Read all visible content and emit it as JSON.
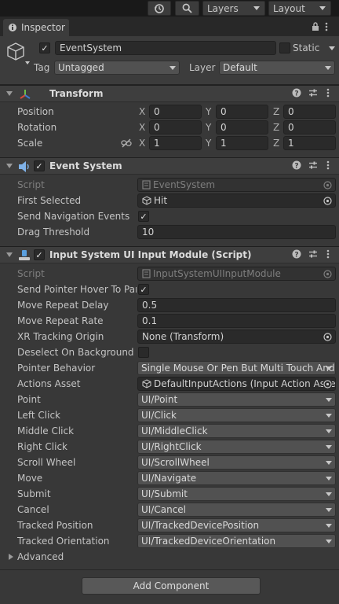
{
  "toolbar": {
    "layers_label": "Layers",
    "layout_label": "Layout"
  },
  "tab": {
    "label": "Inspector"
  },
  "gameobject": {
    "active": true,
    "name": "EventSystem",
    "static_label": "Static",
    "static": false,
    "tag_label": "Tag",
    "tag_value": "Untagged",
    "layer_label": "Layer",
    "layer_value": "Default"
  },
  "transform": {
    "title": "Transform",
    "position_label": "Position",
    "rotation_label": "Rotation",
    "scale_label": "Scale",
    "axis_x": "X",
    "axis_y": "Y",
    "axis_z": "Z",
    "position": [
      "0",
      "0",
      "0"
    ],
    "rotation": [
      "0",
      "0",
      "0"
    ],
    "scale": [
      "1",
      "1",
      "1"
    ]
  },
  "event_system": {
    "title": "Event System",
    "enabled": true,
    "script_label": "Script",
    "script_value": "EventSystem",
    "first_selected_label": "First Selected",
    "first_selected_value": "Hit",
    "send_nav_label": "Send Navigation Events",
    "send_nav_checked": true,
    "drag_threshold_label": "Drag Threshold",
    "drag_threshold_value": "10"
  },
  "input_module": {
    "title": "Input System UI Input Module (Script)",
    "enabled": true,
    "script_label": "Script",
    "script_value": "InputSystemUIInputModule",
    "send_pointer_label": "Send Pointer Hover To Parent",
    "send_pointer_checked": true,
    "move_delay_label": "Move Repeat Delay",
    "move_delay_value": "0.5",
    "move_rate_label": "Move Repeat Rate",
    "move_rate_value": "0.1",
    "xr_origin_label": "XR Tracking Origin",
    "xr_origin_value": "None (Transform)",
    "deselect_label": "Deselect On Background Click",
    "deselect_checked": false,
    "pointer_behavior_label": "Pointer Behavior",
    "pointer_behavior_value": "Single Mouse Or Pen But Multi Touch And Track",
    "actions_asset_label": "Actions Asset",
    "actions_asset_value": "DefaultInputActions (Input Action Asset)",
    "actions": [
      {
        "label": "Point",
        "value": "UI/Point"
      },
      {
        "label": "Left Click",
        "value": "UI/Click"
      },
      {
        "label": "Middle Click",
        "value": "UI/MiddleClick"
      },
      {
        "label": "Right Click",
        "value": "UI/RightClick"
      },
      {
        "label": "Scroll Wheel",
        "value": "UI/ScrollWheel"
      },
      {
        "label": "Move",
        "value": "UI/Navigate"
      },
      {
        "label": "Submit",
        "value": "UI/Submit"
      },
      {
        "label": "Cancel",
        "value": "UI/Cancel"
      },
      {
        "label": "Tracked Position",
        "value": "UI/TrackedDevicePosition"
      },
      {
        "label": "Tracked Orientation",
        "value": "UI/TrackedDeviceOrientation"
      }
    ],
    "advanced_label": "Advanced"
  },
  "add_component_label": "Add Component"
}
